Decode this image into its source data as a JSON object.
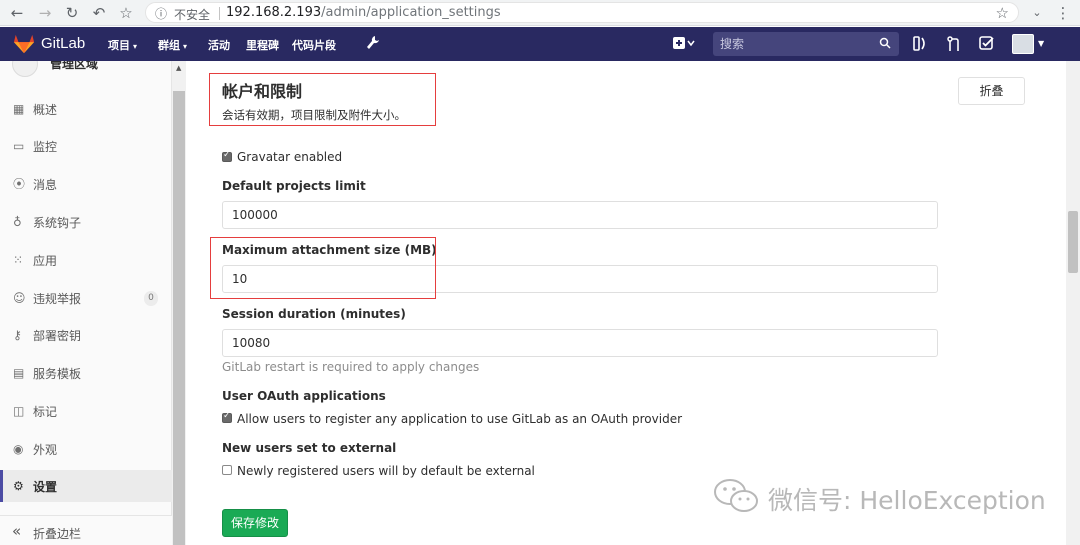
{
  "browser": {
    "insecure_label": "不安全",
    "url_host": "192.168.2.193",
    "url_path": "/admin/application_settings"
  },
  "navbar": {
    "brand": "GitLab",
    "items": [
      {
        "label": "项目",
        "caret": "▾"
      },
      {
        "label": "群组",
        "caret": "▾"
      },
      {
        "label": "活动",
        "caret": ""
      },
      {
        "label": "里程碑",
        "caret": ""
      },
      {
        "label": "代码片段",
        "caret": ""
      }
    ],
    "search_placeholder": "搜索"
  },
  "sidebar": {
    "header": "管理区域",
    "items": [
      {
        "label": "概述",
        "icon": "overview-icon",
        "active": false
      },
      {
        "label": "监控",
        "icon": "monitor-icon",
        "active": false
      },
      {
        "label": "消息",
        "icon": "messages-icon",
        "active": false
      },
      {
        "label": "系统钩子",
        "icon": "hook-icon",
        "active": false
      },
      {
        "label": "应用",
        "icon": "applications-icon",
        "active": false
      },
      {
        "label": "违规举报",
        "icon": "abuse-icon",
        "active": false,
        "badge": "0"
      },
      {
        "label": "部署密钥",
        "icon": "key-icon",
        "active": false
      },
      {
        "label": "服务模板",
        "icon": "template-icon",
        "active": false
      },
      {
        "label": "标记",
        "icon": "labels-icon",
        "active": false
      },
      {
        "label": "外观",
        "icon": "appearance-icon",
        "active": false
      },
      {
        "label": "设置",
        "icon": "settings-icon",
        "active": true
      }
    ],
    "collapse_label": "折叠边栏"
  },
  "section": {
    "title": "帐户和限制",
    "description": "会话有效期，项目限制及附件大小。",
    "collapse_button": "折叠"
  },
  "form": {
    "gravatar_label": "Gravatar enabled",
    "gravatar_checked": true,
    "projects_limit_label": "Default projects limit",
    "projects_limit_value": "100000",
    "attachment_size_label": "Maximum attachment size (MB)",
    "attachment_size_value": "10",
    "session_duration_label": "Session duration (minutes)",
    "session_duration_value": "10080",
    "session_duration_help": "GitLab restart is required to apply changes",
    "oauth_label": "User OAuth applications",
    "oauth_checkbox_label": "Allow users to register any application to use GitLab as an OAuth provider",
    "oauth_checked": true,
    "external_label": "New users set to external",
    "external_checkbox_label": "Newly registered users will by default be external",
    "external_checked": false,
    "save_button": "保存修改"
  },
  "watermark": "微信号: HelloException",
  "colors": {
    "navbar": "#292961",
    "save_button": "#1aaa55",
    "highlight_box": "#e53e3e"
  }
}
